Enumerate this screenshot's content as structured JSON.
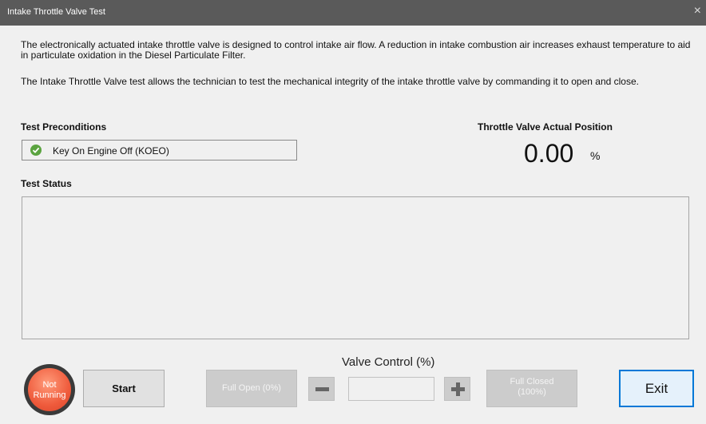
{
  "window": {
    "title": "Intake Throttle Valve Test",
    "close_glyph": "×"
  },
  "description": {
    "paragraph1": "The electronically actuated intake throttle valve is designed to control intake air flow. A reduction in intake combustion air increases exhaust temperature to aid in particulate oxidation in the Diesel Particulate Filter.",
    "paragraph2": "The Intake Throttle Valve test allows the technician to test the mechanical integrity of the intake throttle valve by commanding it to open and close."
  },
  "preconditions": {
    "heading": "Test Preconditions",
    "items": [
      {
        "label": "Key On Engine Off (KOEO)",
        "status_icon": "check-icon",
        "status_color": "#5aa33f"
      }
    ]
  },
  "position": {
    "heading": "Throttle Valve Actual Position",
    "value": "0.00",
    "unit": "%"
  },
  "status": {
    "heading": "Test Status",
    "text": ""
  },
  "indicator": {
    "line1": "Not",
    "line2": "Running",
    "color": "#ef5b3c"
  },
  "controls": {
    "start_label": "Start",
    "valve_control_label": "Valve Control (%)",
    "full_open_label": "Full Open (0%)",
    "full_closed_line1": "Full Closed",
    "full_closed_line2": "(100%)",
    "valve_value": "",
    "decrement_icon": "minus-icon",
    "increment_icon": "plus-icon",
    "exit_label": "Exit"
  },
  "colors": {
    "titlebar": "#5a5a5a",
    "exit_border": "#0078d7"
  }
}
